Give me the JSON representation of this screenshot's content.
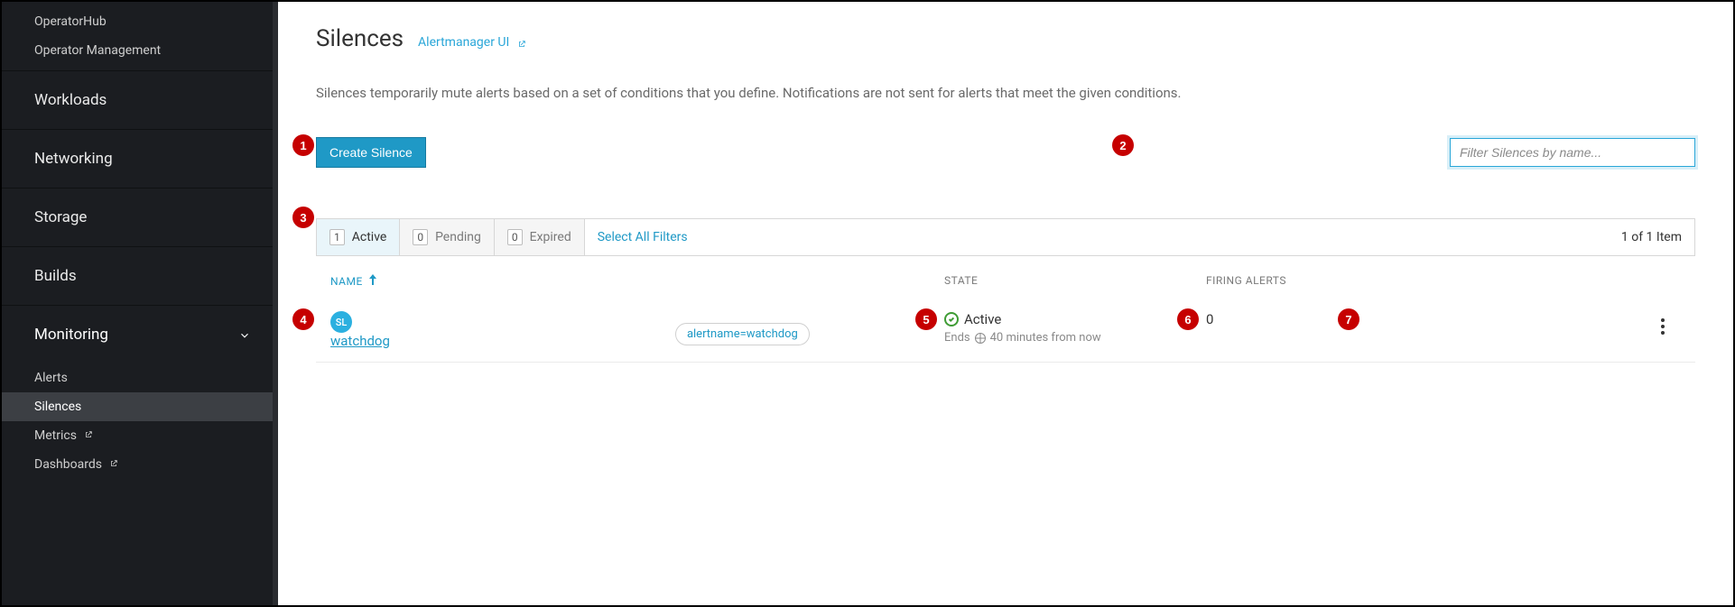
{
  "sidebar": {
    "top_items": [
      "OperatorHub",
      "Operator Management"
    ],
    "sections": [
      {
        "label": "Workloads",
        "expanded": false
      },
      {
        "label": "Networking",
        "expanded": false
      },
      {
        "label": "Storage",
        "expanded": false
      },
      {
        "label": "Builds",
        "expanded": false
      },
      {
        "label": "Monitoring",
        "expanded": true,
        "children": [
          {
            "label": "Alerts",
            "active": false,
            "external": false
          },
          {
            "label": "Silences",
            "active": true,
            "external": false
          },
          {
            "label": "Metrics",
            "active": false,
            "external": true
          },
          {
            "label": "Dashboards",
            "active": false,
            "external": true
          }
        ]
      }
    ]
  },
  "page": {
    "title": "Silences",
    "external_link_label": "Alertmanager UI",
    "description": "Silences temporarily mute alerts based on a set of conditions that you define. Notifications are not sent for alerts that meet the given conditions.",
    "create_button_label": "Create Silence",
    "filter_placeholder": "Filter Silences by name..."
  },
  "filters": {
    "segments": [
      {
        "count": "1",
        "label": "Active",
        "active": true
      },
      {
        "count": "0",
        "label": "Pending",
        "active": false
      },
      {
        "count": "0",
        "label": "Expired",
        "active": false
      }
    ],
    "select_all_label": "Select All Filters",
    "summary": "1 of 1 Item"
  },
  "columns": {
    "name": "NAME",
    "state": "STATE",
    "firing": "FIRING ALERTS"
  },
  "rows": [
    {
      "badge": "SL",
      "title": "watchdog",
      "matcher": "alertname=watchdog",
      "state_label": "Active",
      "ends_prefix": "Ends",
      "ends_time": "40 minutes from now",
      "firing_count": "0"
    }
  ],
  "annotations": [
    "1",
    "2",
    "3",
    "4",
    "5",
    "6",
    "7"
  ]
}
